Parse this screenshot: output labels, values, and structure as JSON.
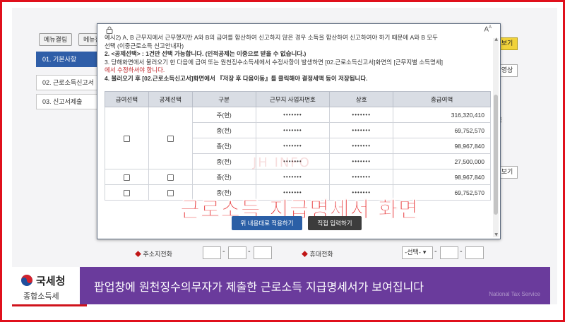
{
  "topbar": {
    "btn_menu": "메뉴결림",
    "btn_menu2": "메뉴장",
    "btn_right": "보기"
  },
  "steps": [
    {
      "label": "01. 기본사항",
      "active": true
    },
    {
      "label": "02. 근로소득신고서",
      "active": false
    },
    {
      "label": "03. 신고서제출",
      "active": false
    }
  ],
  "right_panel": {
    "btn_video": "영상",
    "btn_more": "보기",
    "gray_label": "용"
  },
  "form": {
    "phone_label": "주소지전화",
    "mobile_label": "휴대전화",
    "carrier_select": "-선택-"
  },
  "modal": {
    "notes": [
      "예시2) A, B 근무지에서 근무했지만 A와 B의 급여를 합산하여 신고하지 않은 경우 소득을 합산하여 신고하여야 하기 때문에 A와 B 모두",
      "선택 (이중근로소득 신고안내자)",
      "2. <공제선택> : 1건만 선택 가능합니다. (인적공제는 이중으로 받을 수 없습니다.)",
      "3. 당해화면에서 불러오기 한 다음에 급여 또는 원천징수소득세에서 수정사항이 발생하면 [02.근로소득신고서]화면의 [근무지별 소득명세]",
      "에서 수정하셔야 합니다.",
      "4. 불러오기 후 [02.근로소득신고서]화면에서 『저장 후 다음이동』를 클릭해야 결정세액 등이 저장됩니다."
    ],
    "table": {
      "headers": [
        "급여선택",
        "공제선택",
        "구분",
        "근무지 사업자번호",
        "상호",
        "총급여액"
      ],
      "rows": [
        {
          "type": "주(현)",
          "bizno": "•••••••",
          "name": "•••••••",
          "amount": "316,320,410"
        },
        {
          "type": "종(전)",
          "bizno": "•••••••",
          "name": "•••••••",
          "amount": "69,752,570"
        },
        {
          "type": "종(전)",
          "bizno": "•••••••",
          "name": "•••••••",
          "amount": "98,967,840"
        },
        {
          "type": "종(전)",
          "bizno": "•••••••",
          "name": "•••••••",
          "amount": "27,500,000"
        },
        {
          "type": "종(전)",
          "bizno": "•••••••",
          "name": "•••••••",
          "amount": "98,967,840"
        },
        {
          "type": "종(전)",
          "bizno": "•••••••",
          "name": "•••••••",
          "amount": "69,752,570"
        }
      ]
    },
    "btn_apply": "위 내용대로 적용하기",
    "btn_direct": "직접 입력하기"
  },
  "overlay": {
    "title": "근로소득 지급명세서 화면",
    "watermark": "JH INFO"
  },
  "logo": {
    "name": "국세청",
    "sub": "종합소득세"
  },
  "caption": {
    "text": "팝업창에 원천징수의무자가 제출한 근로소득 지급명세서가 보여집니다",
    "sub": "National Tax Service"
  },
  "colors": {
    "primary": "#2b5fa6",
    "caption_bg": "#6a3b9c",
    "overlay_red": "#e5292b",
    "frame_red": "#e0101c"
  }
}
